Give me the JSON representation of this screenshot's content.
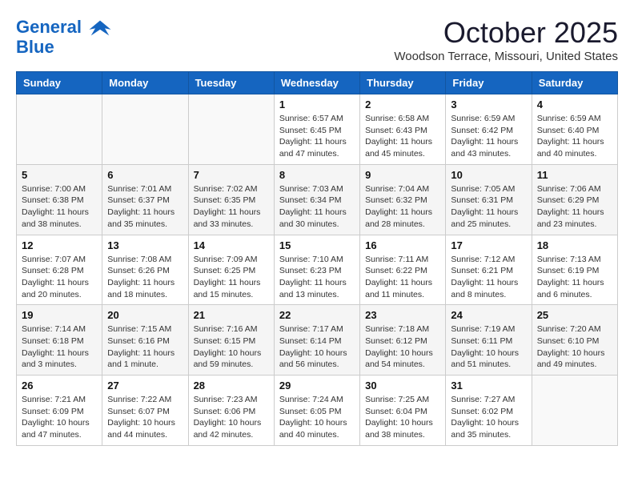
{
  "header": {
    "logo_line1": "General",
    "logo_line2": "Blue",
    "month": "October 2025",
    "location": "Woodson Terrace, Missouri, United States"
  },
  "weekdays": [
    "Sunday",
    "Monday",
    "Tuesday",
    "Wednesday",
    "Thursday",
    "Friday",
    "Saturday"
  ],
  "weeks": [
    [
      {
        "day": "",
        "info": ""
      },
      {
        "day": "",
        "info": ""
      },
      {
        "day": "",
        "info": ""
      },
      {
        "day": "1",
        "info": "Sunrise: 6:57 AM\nSunset: 6:45 PM\nDaylight: 11 hours and 47 minutes."
      },
      {
        "day": "2",
        "info": "Sunrise: 6:58 AM\nSunset: 6:43 PM\nDaylight: 11 hours and 45 minutes."
      },
      {
        "day": "3",
        "info": "Sunrise: 6:59 AM\nSunset: 6:42 PM\nDaylight: 11 hours and 43 minutes."
      },
      {
        "day": "4",
        "info": "Sunrise: 6:59 AM\nSunset: 6:40 PM\nDaylight: 11 hours and 40 minutes."
      }
    ],
    [
      {
        "day": "5",
        "info": "Sunrise: 7:00 AM\nSunset: 6:38 PM\nDaylight: 11 hours and 38 minutes."
      },
      {
        "day": "6",
        "info": "Sunrise: 7:01 AM\nSunset: 6:37 PM\nDaylight: 11 hours and 35 minutes."
      },
      {
        "day": "7",
        "info": "Sunrise: 7:02 AM\nSunset: 6:35 PM\nDaylight: 11 hours and 33 minutes."
      },
      {
        "day": "8",
        "info": "Sunrise: 7:03 AM\nSunset: 6:34 PM\nDaylight: 11 hours and 30 minutes."
      },
      {
        "day": "9",
        "info": "Sunrise: 7:04 AM\nSunset: 6:32 PM\nDaylight: 11 hours and 28 minutes."
      },
      {
        "day": "10",
        "info": "Sunrise: 7:05 AM\nSunset: 6:31 PM\nDaylight: 11 hours and 25 minutes."
      },
      {
        "day": "11",
        "info": "Sunrise: 7:06 AM\nSunset: 6:29 PM\nDaylight: 11 hours and 23 minutes."
      }
    ],
    [
      {
        "day": "12",
        "info": "Sunrise: 7:07 AM\nSunset: 6:28 PM\nDaylight: 11 hours and 20 minutes."
      },
      {
        "day": "13",
        "info": "Sunrise: 7:08 AM\nSunset: 6:26 PM\nDaylight: 11 hours and 18 minutes."
      },
      {
        "day": "14",
        "info": "Sunrise: 7:09 AM\nSunset: 6:25 PM\nDaylight: 11 hours and 15 minutes."
      },
      {
        "day": "15",
        "info": "Sunrise: 7:10 AM\nSunset: 6:23 PM\nDaylight: 11 hours and 13 minutes."
      },
      {
        "day": "16",
        "info": "Sunrise: 7:11 AM\nSunset: 6:22 PM\nDaylight: 11 hours and 11 minutes."
      },
      {
        "day": "17",
        "info": "Sunrise: 7:12 AM\nSunset: 6:21 PM\nDaylight: 11 hours and 8 minutes."
      },
      {
        "day": "18",
        "info": "Sunrise: 7:13 AM\nSunset: 6:19 PM\nDaylight: 11 hours and 6 minutes."
      }
    ],
    [
      {
        "day": "19",
        "info": "Sunrise: 7:14 AM\nSunset: 6:18 PM\nDaylight: 11 hours and 3 minutes."
      },
      {
        "day": "20",
        "info": "Sunrise: 7:15 AM\nSunset: 6:16 PM\nDaylight: 11 hours and 1 minute."
      },
      {
        "day": "21",
        "info": "Sunrise: 7:16 AM\nSunset: 6:15 PM\nDaylight: 10 hours and 59 minutes."
      },
      {
        "day": "22",
        "info": "Sunrise: 7:17 AM\nSunset: 6:14 PM\nDaylight: 10 hours and 56 minutes."
      },
      {
        "day": "23",
        "info": "Sunrise: 7:18 AM\nSunset: 6:12 PM\nDaylight: 10 hours and 54 minutes."
      },
      {
        "day": "24",
        "info": "Sunrise: 7:19 AM\nSunset: 6:11 PM\nDaylight: 10 hours and 51 minutes."
      },
      {
        "day": "25",
        "info": "Sunrise: 7:20 AM\nSunset: 6:10 PM\nDaylight: 10 hours and 49 minutes."
      }
    ],
    [
      {
        "day": "26",
        "info": "Sunrise: 7:21 AM\nSunset: 6:09 PM\nDaylight: 10 hours and 47 minutes."
      },
      {
        "day": "27",
        "info": "Sunrise: 7:22 AM\nSunset: 6:07 PM\nDaylight: 10 hours and 44 minutes."
      },
      {
        "day": "28",
        "info": "Sunrise: 7:23 AM\nSunset: 6:06 PM\nDaylight: 10 hours and 42 minutes."
      },
      {
        "day": "29",
        "info": "Sunrise: 7:24 AM\nSunset: 6:05 PM\nDaylight: 10 hours and 40 minutes."
      },
      {
        "day": "30",
        "info": "Sunrise: 7:25 AM\nSunset: 6:04 PM\nDaylight: 10 hours and 38 minutes."
      },
      {
        "day": "31",
        "info": "Sunrise: 7:27 AM\nSunset: 6:02 PM\nDaylight: 10 hours and 35 minutes."
      },
      {
        "day": "",
        "info": ""
      }
    ]
  ]
}
